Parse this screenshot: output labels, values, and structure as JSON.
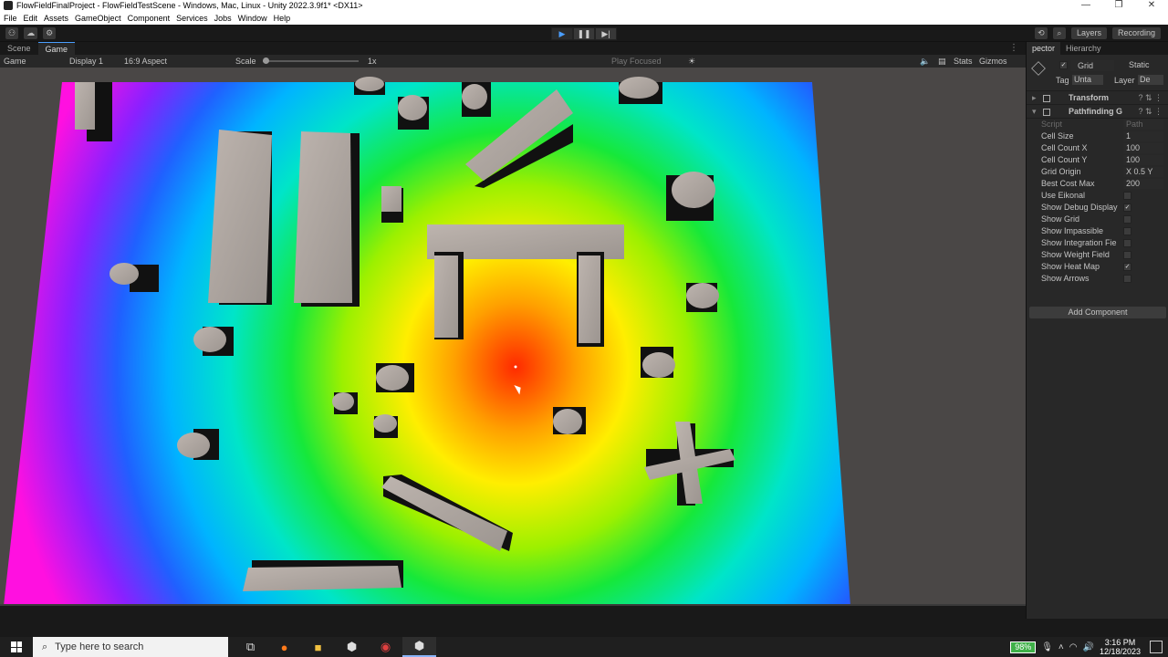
{
  "window": {
    "title": "FlowFieldFinalProject - FlowFieldTestScene - Windows, Mac, Linux - Unity 2022.3.9f1* <DX11>",
    "controls": [
      "—",
      "❐",
      "✕"
    ]
  },
  "menu": [
    "File",
    "Edit",
    "Assets",
    "GameObject",
    "Component",
    "Services",
    "Jobs",
    "Window",
    "Help"
  ],
  "toolbar": {
    "play": "▶",
    "pause": "❚❚",
    "step": "▶|",
    "layers": "Layers",
    "layout": "Recording"
  },
  "view_tabs": [
    "Scene",
    "Game"
  ],
  "game_toolbar": {
    "mode": "Game",
    "display": "Display 1",
    "aspect": "16:9 Aspect",
    "scale_label": "Scale",
    "scale_value": "1x",
    "play_focused": "Play Focused",
    "stats": "Stats",
    "gizmos": "Gizmos"
  },
  "inspector": {
    "tabs": [
      "pector",
      "Hierarchy"
    ],
    "object_name": "Grid",
    "active": true,
    "static_label": "Static",
    "tag_label": "Tag",
    "tag_value": "Unta",
    "layer_label": "Layer",
    "layer_value": "De",
    "components": [
      {
        "name": "Transform"
      },
      {
        "name": "Pathfinding G"
      }
    ],
    "properties": [
      {
        "label": "Script",
        "value": "Path",
        "dim": true
      },
      {
        "label": "Cell Size",
        "value": "1"
      },
      {
        "label": "Cell Count X",
        "value": "100"
      },
      {
        "label": "Cell Count Y",
        "value": "100"
      },
      {
        "label": "Grid Origin",
        "value": "X 0.5 Y"
      },
      {
        "label": "Best Cost Max",
        "value": "200"
      },
      {
        "label": "Use Eikonal",
        "checked": false
      },
      {
        "label": "Show Debug Display",
        "checked": true
      },
      {
        "label": "Show Grid",
        "checked": false
      },
      {
        "label": "Show Impassible",
        "checked": false
      },
      {
        "label": "Show Integration Fie",
        "checked": false
      },
      {
        "label": "Show Weight Field",
        "checked": false
      },
      {
        "label": "Show Heat Map",
        "checked": true
      },
      {
        "label": "Show Arrows",
        "checked": false
      }
    ],
    "add_component": "Add Component"
  },
  "taskbar": {
    "search_placeholder": "Type here to search",
    "battery": "98%",
    "time": "3:16 PM",
    "date": "12/18/2023"
  }
}
